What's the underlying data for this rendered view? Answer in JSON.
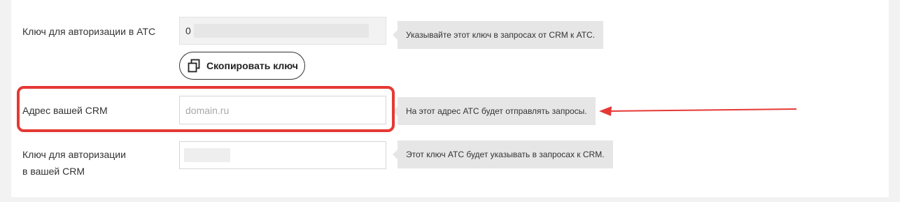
{
  "rows": {
    "ats_key": {
      "label": "Ключ для авторизации в АТС",
      "value": "0",
      "hint": "Указывайте этот ключ в запросах от CRM к АТС."
    },
    "copy_button": {
      "label": "Скопировать ключ",
      "icon": "copy-icon"
    },
    "crm_address": {
      "label": "Адрес вашей CRM",
      "placeholder": "domain.ru",
      "value": "",
      "hint": "На этот адрес АТС будет отправлять запросы."
    },
    "crm_key": {
      "label_line1": "Ключ для авторизации",
      "label_line2": "в вашей CRM",
      "value": "",
      "hint": "Этот ключ АТС будет указывать в запросах к CRM."
    }
  },
  "annotation": {
    "highlight_color": "#e53935",
    "arrow_color": "#e53935"
  }
}
